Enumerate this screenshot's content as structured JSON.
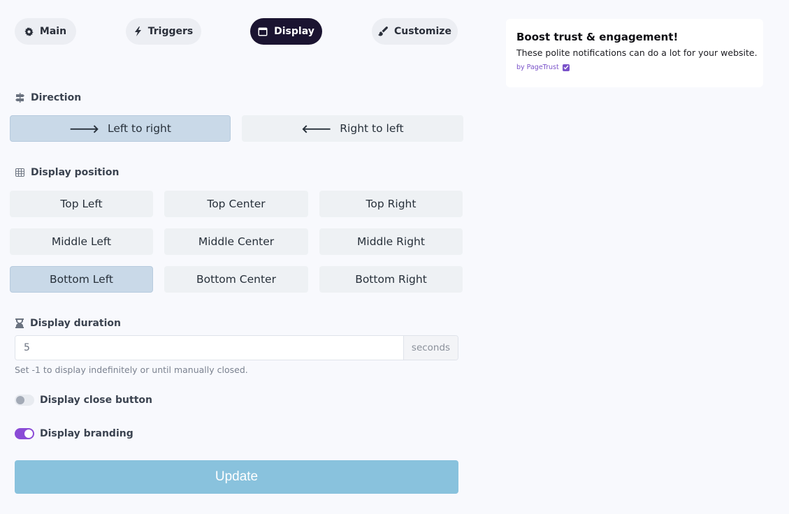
{
  "tabs": [
    {
      "label": "Main",
      "icon": "gear-icon"
    },
    {
      "label": "Triggers",
      "icon": "bolt-icon"
    },
    {
      "label": "Display",
      "icon": "window-icon",
      "active": true
    },
    {
      "label": "Customize",
      "icon": "brush-icon"
    }
  ],
  "direction": {
    "label": "Direction",
    "icon": "signpost-icon",
    "options": [
      {
        "label": "Left to right",
        "icon": "arrow-right-icon",
        "selected": true
      },
      {
        "label": "Right to left",
        "icon": "arrow-left-icon",
        "selected": false
      }
    ]
  },
  "position": {
    "label": "Display position",
    "icon": "grid-icon",
    "options": [
      {
        "label": "Top Left"
      },
      {
        "label": "Top Center"
      },
      {
        "label": "Top Right"
      },
      {
        "label": "Middle Left"
      },
      {
        "label": "Middle Center"
      },
      {
        "label": "Middle Right"
      },
      {
        "label": "Bottom Left",
        "selected": true
      },
      {
        "label": "Bottom Center"
      },
      {
        "label": "Bottom Right"
      }
    ]
  },
  "duration": {
    "label": "Display duration",
    "icon": "hourglass-icon",
    "value": "5",
    "suffix": "seconds",
    "help": "Set -1 to display indefinitely or until manually closed."
  },
  "close_button": {
    "label": "Display close button",
    "enabled": false
  },
  "branding": {
    "label": "Display branding",
    "enabled": true
  },
  "update_label": "Update",
  "preview": {
    "title": "Boost trust & engagement!",
    "description": "These polite notifications can do a lot for your website.",
    "brand": "by PageTrust"
  },
  "colors": {
    "active_tab": "#1b1431",
    "selected_option": "#c9d9e8",
    "toggle_on": "#8a4bd6",
    "update_button": "#89c2dd",
    "brand": "#7a52c9"
  }
}
